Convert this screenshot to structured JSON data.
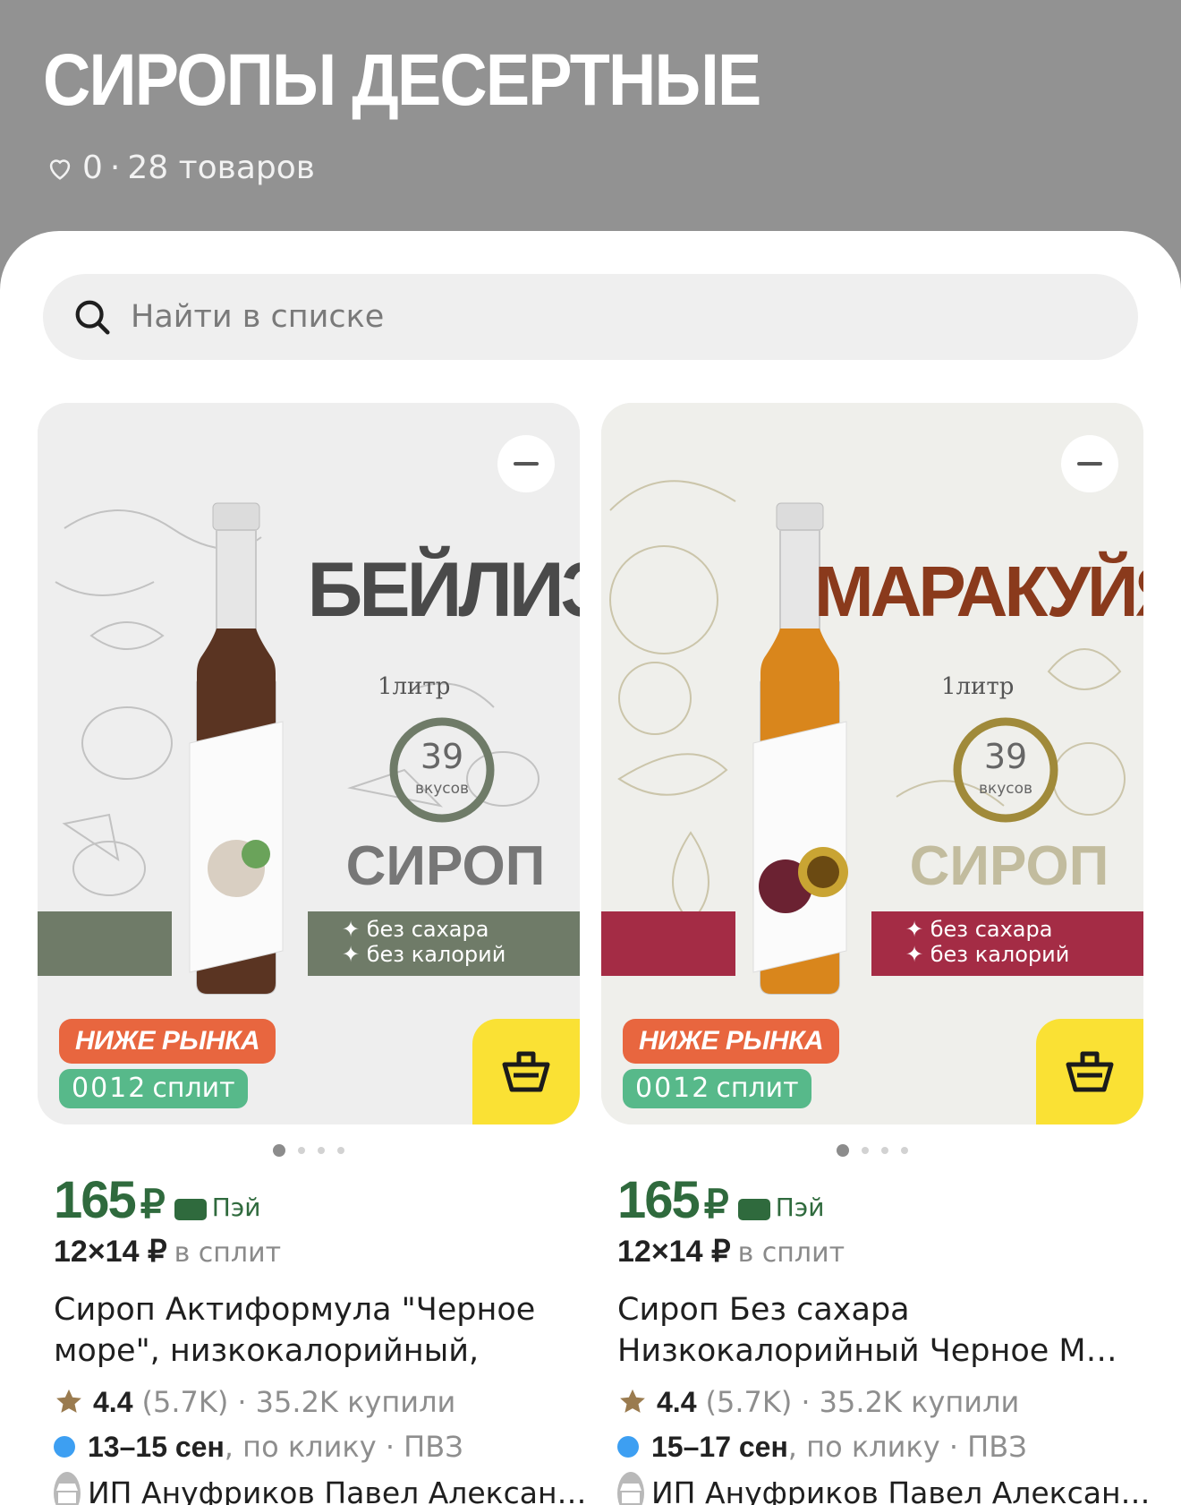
{
  "header": {
    "title": "СИРОПЫ ДЕСЕРТНЫЕ",
    "likes": "0",
    "separator": "·",
    "count_label": "28 товаров"
  },
  "search": {
    "placeholder": "Найти в списке",
    "value": ""
  },
  "products": [
    {
      "art": {
        "flavor": "БЕЙЛИЗ",
        "volume": "1литр",
        "tastes_num": "39",
        "tastes_word": "вкусов",
        "product": "СИРОП",
        "bullet1": "✦ без сахара",
        "bullet2": "✦ без калорий",
        "accent": "#6f7b68",
        "liquid": "#5a3422",
        "flavor_color": "#4a4a4a"
      },
      "badge_low": "НИЖЕ РЫНКА",
      "split_code": "0012",
      "split_word": "сплит",
      "price": "165",
      "currency": "₽",
      "pay_label": "Пэй",
      "split_amount": "12×14 ₽",
      "split_suffix": "в сплит",
      "name": "Сироп Актиформула \"Черное море\", низкокалорийный, бе…",
      "rating": "4.4",
      "reviews": "(5.7K)",
      "bought": "· 35.2K купили",
      "delivery_date": "13–15 сен",
      "delivery_rest": ", по клику · ПВЗ",
      "seller": "ИП Ануфриков Павел Алексан…",
      "dots_total": 4,
      "dots_active": 1
    },
    {
      "art": {
        "flavor": "МАРАКУЙЯ",
        "volume": "1литр",
        "tastes_num": "39",
        "tastes_word": "вкусов",
        "product": "СИРОП",
        "bullet1": "✦ без сахара",
        "bullet2": "✦ без калорий",
        "accent": "#a42c45",
        "liquid": "#d9861c",
        "flavor_color": "#8a3a1c"
      },
      "badge_low": "НИЖЕ РЫНКА",
      "split_code": "0012",
      "split_word": "сплит",
      "price": "165",
      "currency": "₽",
      "pay_label": "Пэй",
      "split_amount": "12×14 ₽",
      "split_suffix": "в сплит",
      "name": "Сироп Без сахара Низкокалорийный Черное М…",
      "rating": "4.4",
      "reviews": "(5.7K)",
      "bought": "· 35.2K купили",
      "delivery_date": "15–17 сен",
      "delivery_rest": ", по клику · ПВЗ",
      "seller": "ИП Ануфриков Павел Алексан…",
      "dots_total": 4,
      "dots_active": 1
    }
  ],
  "colors": {
    "header_bg": "#929292",
    "price_green": "#2f6a3d",
    "cart_yellow": "#fae134",
    "badge_orange": "#e8663f",
    "split_green": "#57b98a",
    "delivery_blue": "#3d9ff2"
  },
  "icons": {
    "likes": "heart-icon",
    "search": "search-icon",
    "remove": "minus-icon",
    "cart": "basket-icon",
    "pay": "card-icon",
    "rating": "star-icon",
    "delivery": "dot-icon",
    "seller": "shop-icon"
  }
}
